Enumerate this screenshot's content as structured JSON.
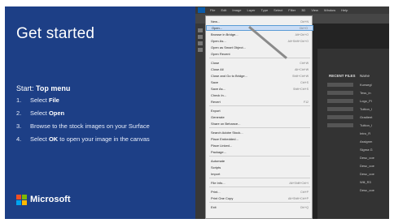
{
  "left_panel": {
    "title": "Get started",
    "start_prefix": "Start: ",
    "start_bold": "Top menu",
    "steps": [
      {
        "num": "1.",
        "pre": "Select ",
        "bold": "File",
        "post": ""
      },
      {
        "num": "2.",
        "pre": "Select ",
        "bold": "Open",
        "post": ""
      },
      {
        "num": "3.",
        "pre": "Browse to the stock images on your Surface",
        "bold": "",
        "post": ""
      },
      {
        "num": "4.",
        "pre": "Select ",
        "bold": "OK",
        "post": " to open your image in the canvas"
      }
    ],
    "brand": "Microsoft",
    "logo_colors": [
      "#f25022",
      "#7fba00",
      "#00a4ef",
      "#ffb900"
    ]
  },
  "app": {
    "menubar": [
      "File",
      "Edit",
      "Image",
      "Layer",
      "Type",
      "Select",
      "Filter",
      "3D",
      "View",
      "Window",
      "Help"
    ],
    "file_menu": {
      "items": [
        {
          "label": "New...",
          "shortcut": "Ctrl+N",
          "selected": false
        },
        {
          "label": "Open...",
          "shortcut": "Ctrl+O",
          "selected": true
        },
        {
          "label": "Browse in Bridge...",
          "shortcut": "Alt+Ctrl+O",
          "selected": false
        },
        {
          "label": "Open As...",
          "shortcut": "Alt+Shift+Ctrl+O",
          "selected": false
        },
        {
          "label": "Open as Smart Object...",
          "shortcut": "",
          "selected": false
        },
        {
          "label": "Open Recent",
          "shortcut": "",
          "selected": false
        },
        {
          "label": "Close",
          "shortcut": "Ctrl+W",
          "selected": false
        },
        {
          "label": "Close All",
          "shortcut": "Alt+Ctrl+W",
          "selected": false
        },
        {
          "label": "Close and Go to Bridge...",
          "shortcut": "Shift+Ctrl+W",
          "selected": false
        },
        {
          "label": "Save",
          "shortcut": "Ctrl+S",
          "selected": false
        },
        {
          "label": "Save As...",
          "shortcut": "Shift+Ctrl+S",
          "selected": false
        },
        {
          "label": "Check In...",
          "shortcut": "",
          "selected": false
        },
        {
          "label": "Revert",
          "shortcut": "F12",
          "selected": false
        },
        {
          "label": "Export",
          "shortcut": "",
          "selected": false
        },
        {
          "label": "Generate",
          "shortcut": "",
          "selected": false
        },
        {
          "label": "Share on Behance...",
          "shortcut": "",
          "selected": false
        },
        {
          "label": "Search Adobe Stock...",
          "shortcut": "",
          "selected": false
        },
        {
          "label": "Place Embedded...",
          "shortcut": "",
          "selected": false
        },
        {
          "label": "Place Linked...",
          "shortcut": "",
          "selected": false
        },
        {
          "label": "Package...",
          "shortcut": "",
          "selected": false
        },
        {
          "label": "Automate",
          "shortcut": "",
          "selected": false
        },
        {
          "label": "Scripts",
          "shortcut": "",
          "selected": false
        },
        {
          "label": "Import",
          "shortcut": "",
          "selected": false
        },
        {
          "label": "File Info...",
          "shortcut": "Alt+Shift+Ctrl+I",
          "selected": false
        },
        {
          "label": "Print...",
          "shortcut": "Ctrl+P",
          "selected": false
        },
        {
          "label": "Print One Copy",
          "shortcut": "Alt+Shift+Ctrl+P",
          "selected": false
        },
        {
          "label": "Exit",
          "shortcut": "Ctrl+Q",
          "selected": false
        }
      ]
    },
    "panel": {
      "recent_header": "RECENT FILES",
      "name_header": "Name",
      "names": [
        "Kurwegl",
        "Tess_in",
        "Logo_Pl",
        "Tuition_I",
        "Gradient",
        "Tuition_I",
        "Intro_R",
        "Assignm",
        "Sigma G",
        "Desc_coe",
        "Desc_coe",
        "Desc_coe",
        "Will_R3",
        "Desc_coe"
      ]
    }
  }
}
